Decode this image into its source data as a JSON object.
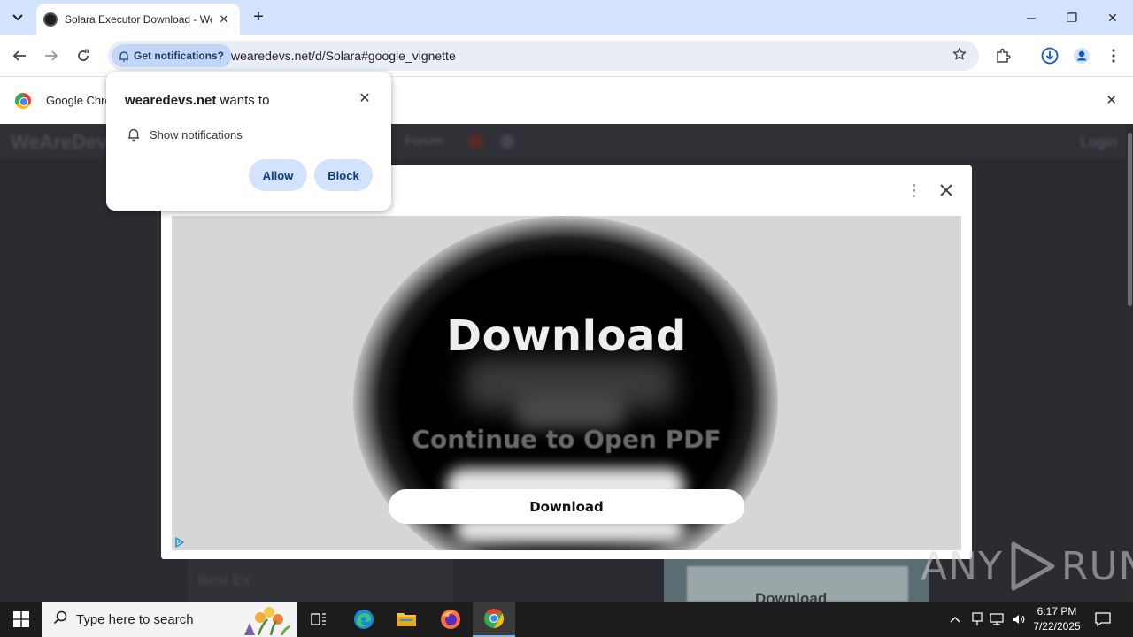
{
  "browser": {
    "tab_title": "Solara Executor Download - We",
    "tab_close": "✕",
    "new_tab": "+",
    "notif_chip": "Get notifications?",
    "url": "wearedevs.net/d/Solara#google_vignette",
    "infobar_text": "Google Chro",
    "infobar_close": "✕"
  },
  "window_controls": {
    "minimize": "─",
    "restore": "❐",
    "close": "✕"
  },
  "permission_prompt": {
    "site": "wearedevs.net",
    "title_suffix": " wants to",
    "item": "Show notifications",
    "allow": "Allow",
    "block": "Block",
    "close": "✕"
  },
  "background_page": {
    "logo": "WeAreDevs",
    "forum": "Forum",
    "login": "Login",
    "bottom_left_text": "Best Ex",
    "download_card_text": "Download"
  },
  "ad": {
    "headline": "Download",
    "subtext": "Continue to Open PDF",
    "button": "Download",
    "more": "⋮"
  },
  "watermark": {
    "left": "ANY",
    "right": "RUN"
  },
  "taskbar": {
    "search_placeholder": "Type here to search",
    "time": "6:17 PM",
    "date": "7/22/2025"
  },
  "colors": {
    "tabstrip": "#d3e3fd",
    "omnibox": "#e9eef6",
    "chip": "#c2d7f7",
    "prompt_button": "#d3e3fd",
    "page_bg": "#2a2c31",
    "ad_bg": "#d6d6d6",
    "taskbar": "#1c1c1c"
  }
}
